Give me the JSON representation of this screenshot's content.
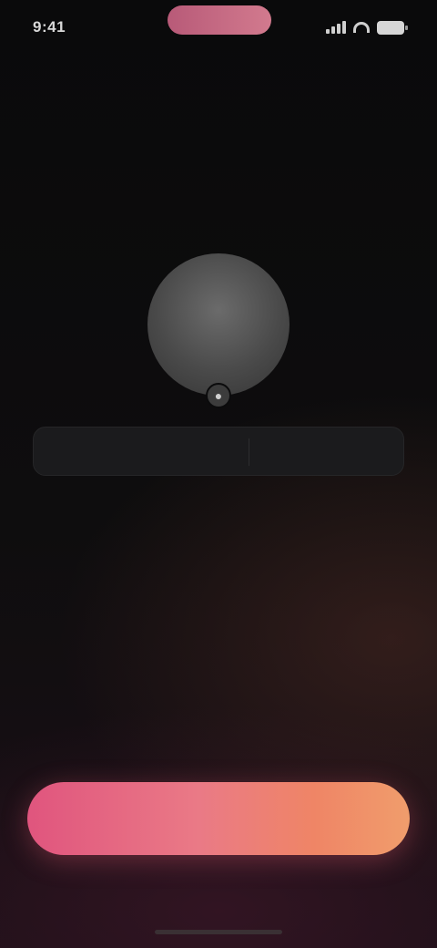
{
  "status_bar": {
    "time": "9:41",
    "pill_label": "",
    "icons": [
      "signal-icon",
      "wifi-icon",
      "battery-icon"
    ]
  },
  "header": {
    "title": "",
    "subtitle": ""
  },
  "profile": {
    "avatar_initials": "",
    "edit_icon": "camera-icon"
  },
  "name_field": {
    "value": "",
    "placeholder": ""
  },
  "hint": {
    "text": ""
  },
  "actions": {
    "continue_label": "",
    "skip_label": ""
  },
  "colors": {
    "background": "#0b0b0c",
    "accent_start": "#e0557e",
    "accent_end": "#f09d6c"
  }
}
